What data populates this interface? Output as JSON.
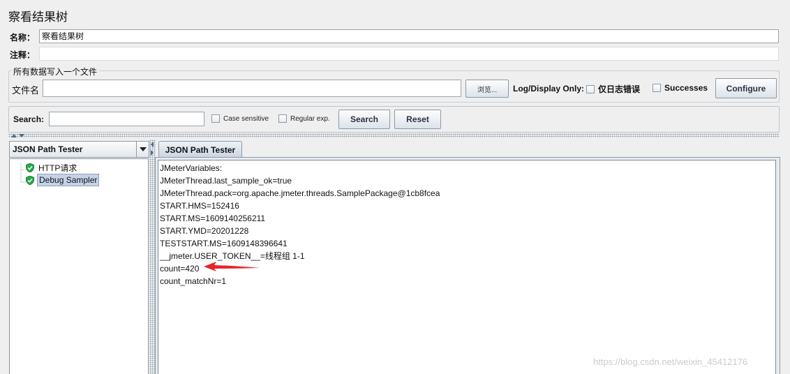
{
  "title": "察看结果树",
  "name_label": "名称：",
  "name_value": "察看结果树",
  "comment_label": "注释：",
  "comment_value": "",
  "file_group": {
    "legend": "所有数据写入一个文件",
    "filename_label": "文件名",
    "filename_value": "",
    "browse_label": "浏览...",
    "log_display_label": "Log/Display Only:",
    "errors_label": "仅日志错误",
    "errors_checked": false,
    "successes_label": "Successes",
    "successes_checked": false,
    "configure_label": "Configure"
  },
  "search": {
    "label": "Search:",
    "value": "",
    "case_sensitive_label": "Case sensitive",
    "case_sensitive_checked": false,
    "regex_label": "Regular exp.",
    "regex_checked": false,
    "search_button": "Search",
    "reset_button": "Reset"
  },
  "renderer_select": "JSON Path Tester",
  "tree": {
    "items": [
      {
        "label": "HTTP请求",
        "status": "success",
        "selected": false
      },
      {
        "label": "Debug Sampler",
        "status": "success",
        "selected": true
      }
    ]
  },
  "result_tab": "JSON Path Tester",
  "result_lines": [
    "JMeterVariables:",
    "JMeterThread.last_sample_ok=true",
    "JMeterThread.pack=org.apache.jmeter.threads.SamplePackage@1cb8fcea",
    "START.HMS=152416",
    "START.MS=1609140256211",
    "START.YMD=20201228",
    "TESTSTART.MS=1609148396641",
    "__jmeter.USER_TOKEN__=线程组 1-1",
    "count=420",
    "count_matchNr=1"
  ],
  "watermark": "https://blog.csdn.net/weixin_45412176",
  "colors": {
    "annotation_arrow": "#e8232a",
    "selection": "#c4d3e8",
    "shield": "#2aa84a"
  }
}
